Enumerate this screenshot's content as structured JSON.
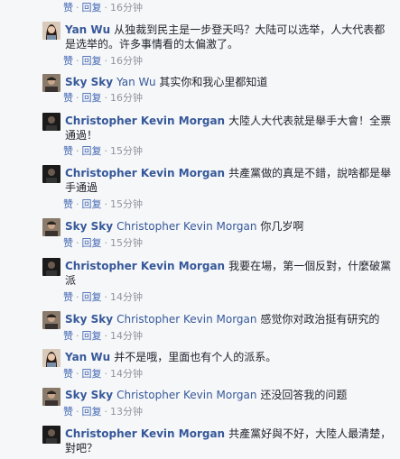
{
  "ui": {
    "like": "赞",
    "reply": "回复",
    "sep": "·"
  },
  "top_time": "16分钟",
  "comments": [
    {
      "author": "Yan Wu",
      "text": "从独裁到民主是一步登天吗？大陆可以选举，人大代表都是选举的。许多事情看的太偏激了。",
      "time": "16分钟",
      "avatar": "woman"
    },
    {
      "author": "Sky Sky",
      "mention": "Yan Wu",
      "text": "其实你和我心里都知道",
      "time": "16分钟",
      "avatar": "man"
    },
    {
      "author": "Christopher Kevin Morgan",
      "text": "大陸人大代表就是舉手大會！全票通過！",
      "time": "15分钟",
      "avatar": "dark"
    },
    {
      "author": "Christopher Kevin Morgan",
      "text": "共產黨做的真是不錯，說啥都是舉手通過",
      "time": "15分钟",
      "avatar": "dark"
    },
    {
      "author": "Sky Sky",
      "mention": "Christopher Kevin Morgan",
      "text": "你几岁啊",
      "time": "15分钟",
      "avatar": "man"
    },
    {
      "author": "Christopher Kevin Morgan",
      "text": "我要在場，第一個反對，什麼破黨派",
      "time": "14分钟",
      "avatar": "dark"
    },
    {
      "author": "Sky Sky",
      "mention": "Christopher Kevin Morgan",
      "text": "感觉你对政治挺有研究的",
      "time": "14分钟",
      "avatar": "man"
    },
    {
      "author": "Yan Wu",
      "text": "并不是哦，里面也有个人的派系。",
      "time": "14分钟",
      "avatar": "woman"
    },
    {
      "author": "Sky Sky",
      "mention": "Christopher Kevin Morgan",
      "text": "还没回答我的问题",
      "time": "13分钟",
      "avatar": "man"
    },
    {
      "author": "Christopher Kevin Morgan",
      "text": "共產黨好與不好，大陸人最清楚，對吧？",
      "avatar": "dark"
    }
  ]
}
